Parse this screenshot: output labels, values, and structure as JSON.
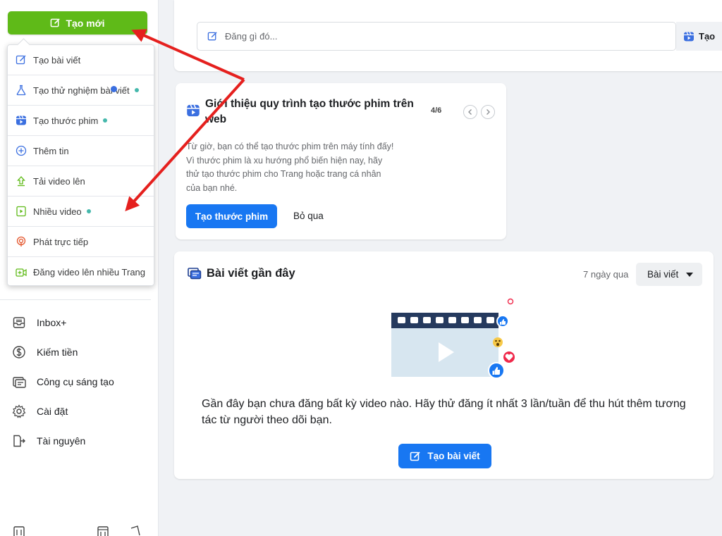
{
  "sidebar": {
    "create_button": "Tạo mới",
    "menu": [
      {
        "label": "Tạo bài viết",
        "icon": "edit-icon",
        "dot": false
      },
      {
        "label": "Tạo thử nghiệm bài viết",
        "icon": "flask-icon",
        "dot": true
      },
      {
        "label": "Tạo thước phim",
        "icon": "reels-icon",
        "dot": true
      },
      {
        "label": "Thêm tin",
        "icon": "plus-circle-icon",
        "dot": false
      },
      {
        "label": "Tải video lên",
        "icon": "upload-icon",
        "dot": false
      },
      {
        "label": "Nhiều video",
        "icon": "multi-video-icon",
        "dot": true
      },
      {
        "label": "Phát trực tiếp",
        "icon": "live-icon",
        "dot": false
      },
      {
        "label": "Đăng video lên nhiều Trang",
        "icon": "crosspost-video-icon",
        "dot": false
      }
    ],
    "nav": [
      {
        "label": "Inbox+",
        "icon": "inbox-icon"
      },
      {
        "label": "Kiếm tiền",
        "icon": "dollar-icon"
      },
      {
        "label": "Công cụ sáng tạo",
        "icon": "creative-tools-icon"
      },
      {
        "label": "Cài đặt",
        "icon": "gear-icon"
      },
      {
        "label": "Tài nguyên",
        "icon": "resources-icon"
      }
    ]
  },
  "composer": {
    "placeholder": "Đăng gì đó...",
    "right_label": "Tạo"
  },
  "intro": {
    "title": "Giới thiệu quy trình tạo thước phim trên web",
    "count": "4/6",
    "text": "Từ giờ, bạn có thể tạo thước phim trên máy tính đấy! Vì thước phim là xu hướng phổ biến hiện nay, hãy thử tạo thước phim cho Trang hoặc trang cá nhân của bạn nhé.",
    "primary_label": "Tạo thước phim",
    "skip_label": "Bỏ qua"
  },
  "recent": {
    "title": "Bài viết gần đây",
    "range": "7 ngày qua",
    "filter": "Bài viết",
    "message": "Gần đây bạn chưa đăng bất kỳ video nào. Hãy thử đăng ít nhất 3 lần/tuần để thu hút thêm tương tác từ người theo dõi bạn.",
    "button": "Tạo bài viết"
  },
  "colors": {
    "create_green": "#5fba18",
    "primary_blue": "#1877f2",
    "arrow_red": "#e5201e",
    "new_dot": "#45b8ac"
  }
}
